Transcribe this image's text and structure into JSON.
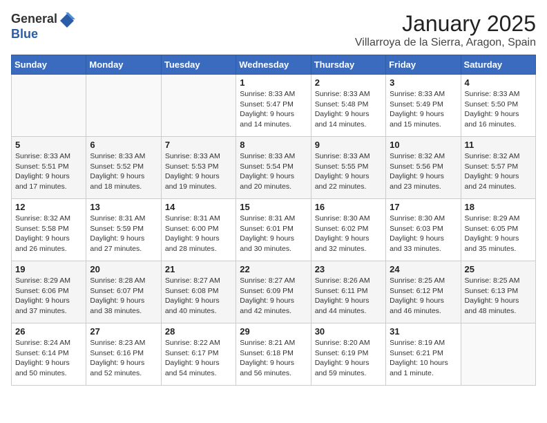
{
  "header": {
    "logo_general": "General",
    "logo_blue": "Blue",
    "month": "January 2025",
    "location": "Villarroya de la Sierra, Aragon, Spain"
  },
  "weekdays": [
    "Sunday",
    "Monday",
    "Tuesday",
    "Wednesday",
    "Thursday",
    "Friday",
    "Saturday"
  ],
  "weeks": [
    [
      {
        "day": "",
        "sunrise": "",
        "sunset": "",
        "daylight": ""
      },
      {
        "day": "",
        "sunrise": "",
        "sunset": "",
        "daylight": ""
      },
      {
        "day": "",
        "sunrise": "",
        "sunset": "",
        "daylight": ""
      },
      {
        "day": "1",
        "sunrise": "Sunrise: 8:33 AM",
        "sunset": "Sunset: 5:47 PM",
        "daylight": "Daylight: 9 hours and 14 minutes."
      },
      {
        "day": "2",
        "sunrise": "Sunrise: 8:33 AM",
        "sunset": "Sunset: 5:48 PM",
        "daylight": "Daylight: 9 hours and 14 minutes."
      },
      {
        "day": "3",
        "sunrise": "Sunrise: 8:33 AM",
        "sunset": "Sunset: 5:49 PM",
        "daylight": "Daylight: 9 hours and 15 minutes."
      },
      {
        "day": "4",
        "sunrise": "Sunrise: 8:33 AM",
        "sunset": "Sunset: 5:50 PM",
        "daylight": "Daylight: 9 hours and 16 minutes."
      }
    ],
    [
      {
        "day": "5",
        "sunrise": "Sunrise: 8:33 AM",
        "sunset": "Sunset: 5:51 PM",
        "daylight": "Daylight: 9 hours and 17 minutes."
      },
      {
        "day": "6",
        "sunrise": "Sunrise: 8:33 AM",
        "sunset": "Sunset: 5:52 PM",
        "daylight": "Daylight: 9 hours and 18 minutes."
      },
      {
        "day": "7",
        "sunrise": "Sunrise: 8:33 AM",
        "sunset": "Sunset: 5:53 PM",
        "daylight": "Daylight: 9 hours and 19 minutes."
      },
      {
        "day": "8",
        "sunrise": "Sunrise: 8:33 AM",
        "sunset": "Sunset: 5:54 PM",
        "daylight": "Daylight: 9 hours and 20 minutes."
      },
      {
        "day": "9",
        "sunrise": "Sunrise: 8:33 AM",
        "sunset": "Sunset: 5:55 PM",
        "daylight": "Daylight: 9 hours and 22 minutes."
      },
      {
        "day": "10",
        "sunrise": "Sunrise: 8:32 AM",
        "sunset": "Sunset: 5:56 PM",
        "daylight": "Daylight: 9 hours and 23 minutes."
      },
      {
        "day": "11",
        "sunrise": "Sunrise: 8:32 AM",
        "sunset": "Sunset: 5:57 PM",
        "daylight": "Daylight: 9 hours and 24 minutes."
      }
    ],
    [
      {
        "day": "12",
        "sunrise": "Sunrise: 8:32 AM",
        "sunset": "Sunset: 5:58 PM",
        "daylight": "Daylight: 9 hours and 26 minutes."
      },
      {
        "day": "13",
        "sunrise": "Sunrise: 8:31 AM",
        "sunset": "Sunset: 5:59 PM",
        "daylight": "Daylight: 9 hours and 27 minutes."
      },
      {
        "day": "14",
        "sunrise": "Sunrise: 8:31 AM",
        "sunset": "Sunset: 6:00 PM",
        "daylight": "Daylight: 9 hours and 28 minutes."
      },
      {
        "day": "15",
        "sunrise": "Sunrise: 8:31 AM",
        "sunset": "Sunset: 6:01 PM",
        "daylight": "Daylight: 9 hours and 30 minutes."
      },
      {
        "day": "16",
        "sunrise": "Sunrise: 8:30 AM",
        "sunset": "Sunset: 6:02 PM",
        "daylight": "Daylight: 9 hours and 32 minutes."
      },
      {
        "day": "17",
        "sunrise": "Sunrise: 8:30 AM",
        "sunset": "Sunset: 6:03 PM",
        "daylight": "Daylight: 9 hours and 33 minutes."
      },
      {
        "day": "18",
        "sunrise": "Sunrise: 8:29 AM",
        "sunset": "Sunset: 6:05 PM",
        "daylight": "Daylight: 9 hours and 35 minutes."
      }
    ],
    [
      {
        "day": "19",
        "sunrise": "Sunrise: 8:29 AM",
        "sunset": "Sunset: 6:06 PM",
        "daylight": "Daylight: 9 hours and 37 minutes."
      },
      {
        "day": "20",
        "sunrise": "Sunrise: 8:28 AM",
        "sunset": "Sunset: 6:07 PM",
        "daylight": "Daylight: 9 hours and 38 minutes."
      },
      {
        "day": "21",
        "sunrise": "Sunrise: 8:27 AM",
        "sunset": "Sunset: 6:08 PM",
        "daylight": "Daylight: 9 hours and 40 minutes."
      },
      {
        "day": "22",
        "sunrise": "Sunrise: 8:27 AM",
        "sunset": "Sunset: 6:09 PM",
        "daylight": "Daylight: 9 hours and 42 minutes."
      },
      {
        "day": "23",
        "sunrise": "Sunrise: 8:26 AM",
        "sunset": "Sunset: 6:11 PM",
        "daylight": "Daylight: 9 hours and 44 minutes."
      },
      {
        "day": "24",
        "sunrise": "Sunrise: 8:25 AM",
        "sunset": "Sunset: 6:12 PM",
        "daylight": "Daylight: 9 hours and 46 minutes."
      },
      {
        "day": "25",
        "sunrise": "Sunrise: 8:25 AM",
        "sunset": "Sunset: 6:13 PM",
        "daylight": "Daylight: 9 hours and 48 minutes."
      }
    ],
    [
      {
        "day": "26",
        "sunrise": "Sunrise: 8:24 AM",
        "sunset": "Sunset: 6:14 PM",
        "daylight": "Daylight: 9 hours and 50 minutes."
      },
      {
        "day": "27",
        "sunrise": "Sunrise: 8:23 AM",
        "sunset": "Sunset: 6:16 PM",
        "daylight": "Daylight: 9 hours and 52 minutes."
      },
      {
        "day": "28",
        "sunrise": "Sunrise: 8:22 AM",
        "sunset": "Sunset: 6:17 PM",
        "daylight": "Daylight: 9 hours and 54 minutes."
      },
      {
        "day": "29",
        "sunrise": "Sunrise: 8:21 AM",
        "sunset": "Sunset: 6:18 PM",
        "daylight": "Daylight: 9 hours and 56 minutes."
      },
      {
        "day": "30",
        "sunrise": "Sunrise: 8:20 AM",
        "sunset": "Sunset: 6:19 PM",
        "daylight": "Daylight: 9 hours and 59 minutes."
      },
      {
        "day": "31",
        "sunrise": "Sunrise: 8:19 AM",
        "sunset": "Sunset: 6:21 PM",
        "daylight": "Daylight: 10 hours and 1 minute."
      },
      {
        "day": "",
        "sunrise": "",
        "sunset": "",
        "daylight": ""
      }
    ]
  ]
}
